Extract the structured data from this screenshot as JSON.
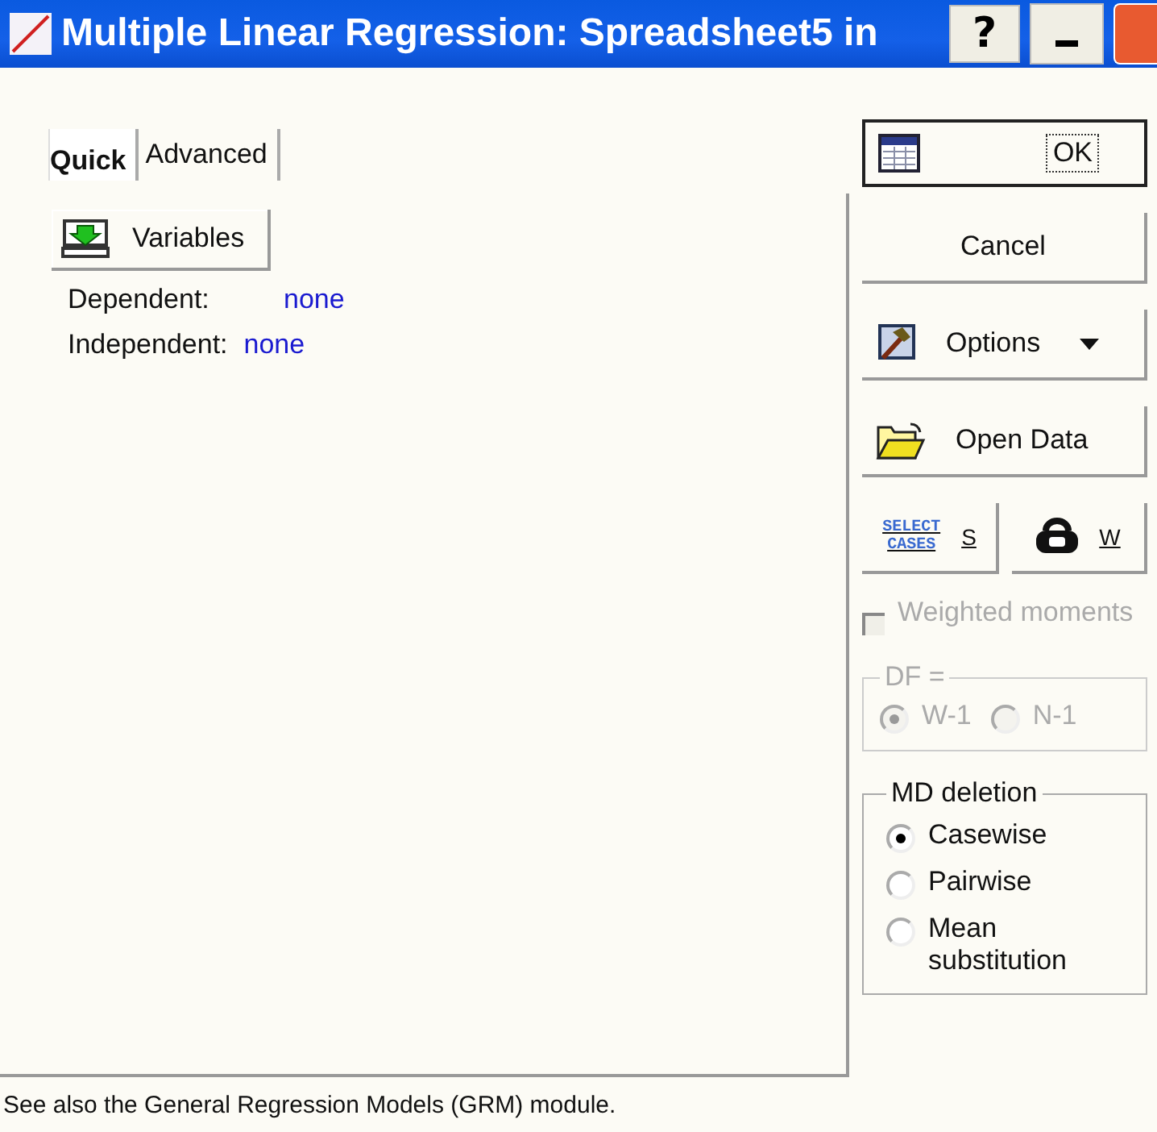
{
  "window": {
    "title": "Multiple Linear Regression: Spreadsheet5 in",
    "help": "?"
  },
  "tabs": [
    {
      "label": "Quick",
      "selected": true
    },
    {
      "label": "Advanced",
      "selected": false
    }
  ],
  "variables_button": "Variables",
  "fields": [
    {
      "label": "Dependent:",
      "value": "none"
    },
    {
      "label": "Independent:",
      "value": "none"
    }
  ],
  "footer": "See also the General Regression Models (GRM) module.",
  "buttons": [
    {
      "kind": "ok",
      "label": "OK"
    },
    {
      "kind": "plain",
      "label": "Cancel"
    },
    {
      "kind": "options",
      "label": "Options"
    },
    {
      "kind": "open",
      "label": "Open Data"
    }
  ],
  "small_buttons": [
    {
      "kind": "select",
      "icon_text": "SELECT CASES",
      "label": "S"
    },
    {
      "kind": "weight",
      "label": "W"
    }
  ],
  "weighted": {
    "label": "Weighted moments",
    "checked": false,
    "disabled": true
  },
  "df_group": {
    "title": "DF =",
    "disabled": true,
    "options": [
      {
        "label": "W-1",
        "selected": true
      },
      {
        "label": "N-1",
        "selected": false
      }
    ]
  },
  "md_group": {
    "title": "MD deletion",
    "disabled": false,
    "options": [
      {
        "label": "Casewise",
        "selected": true
      },
      {
        "label": "Pairwise",
        "selected": false
      },
      {
        "label": "Mean substitution",
        "selected": false
      }
    ]
  }
}
